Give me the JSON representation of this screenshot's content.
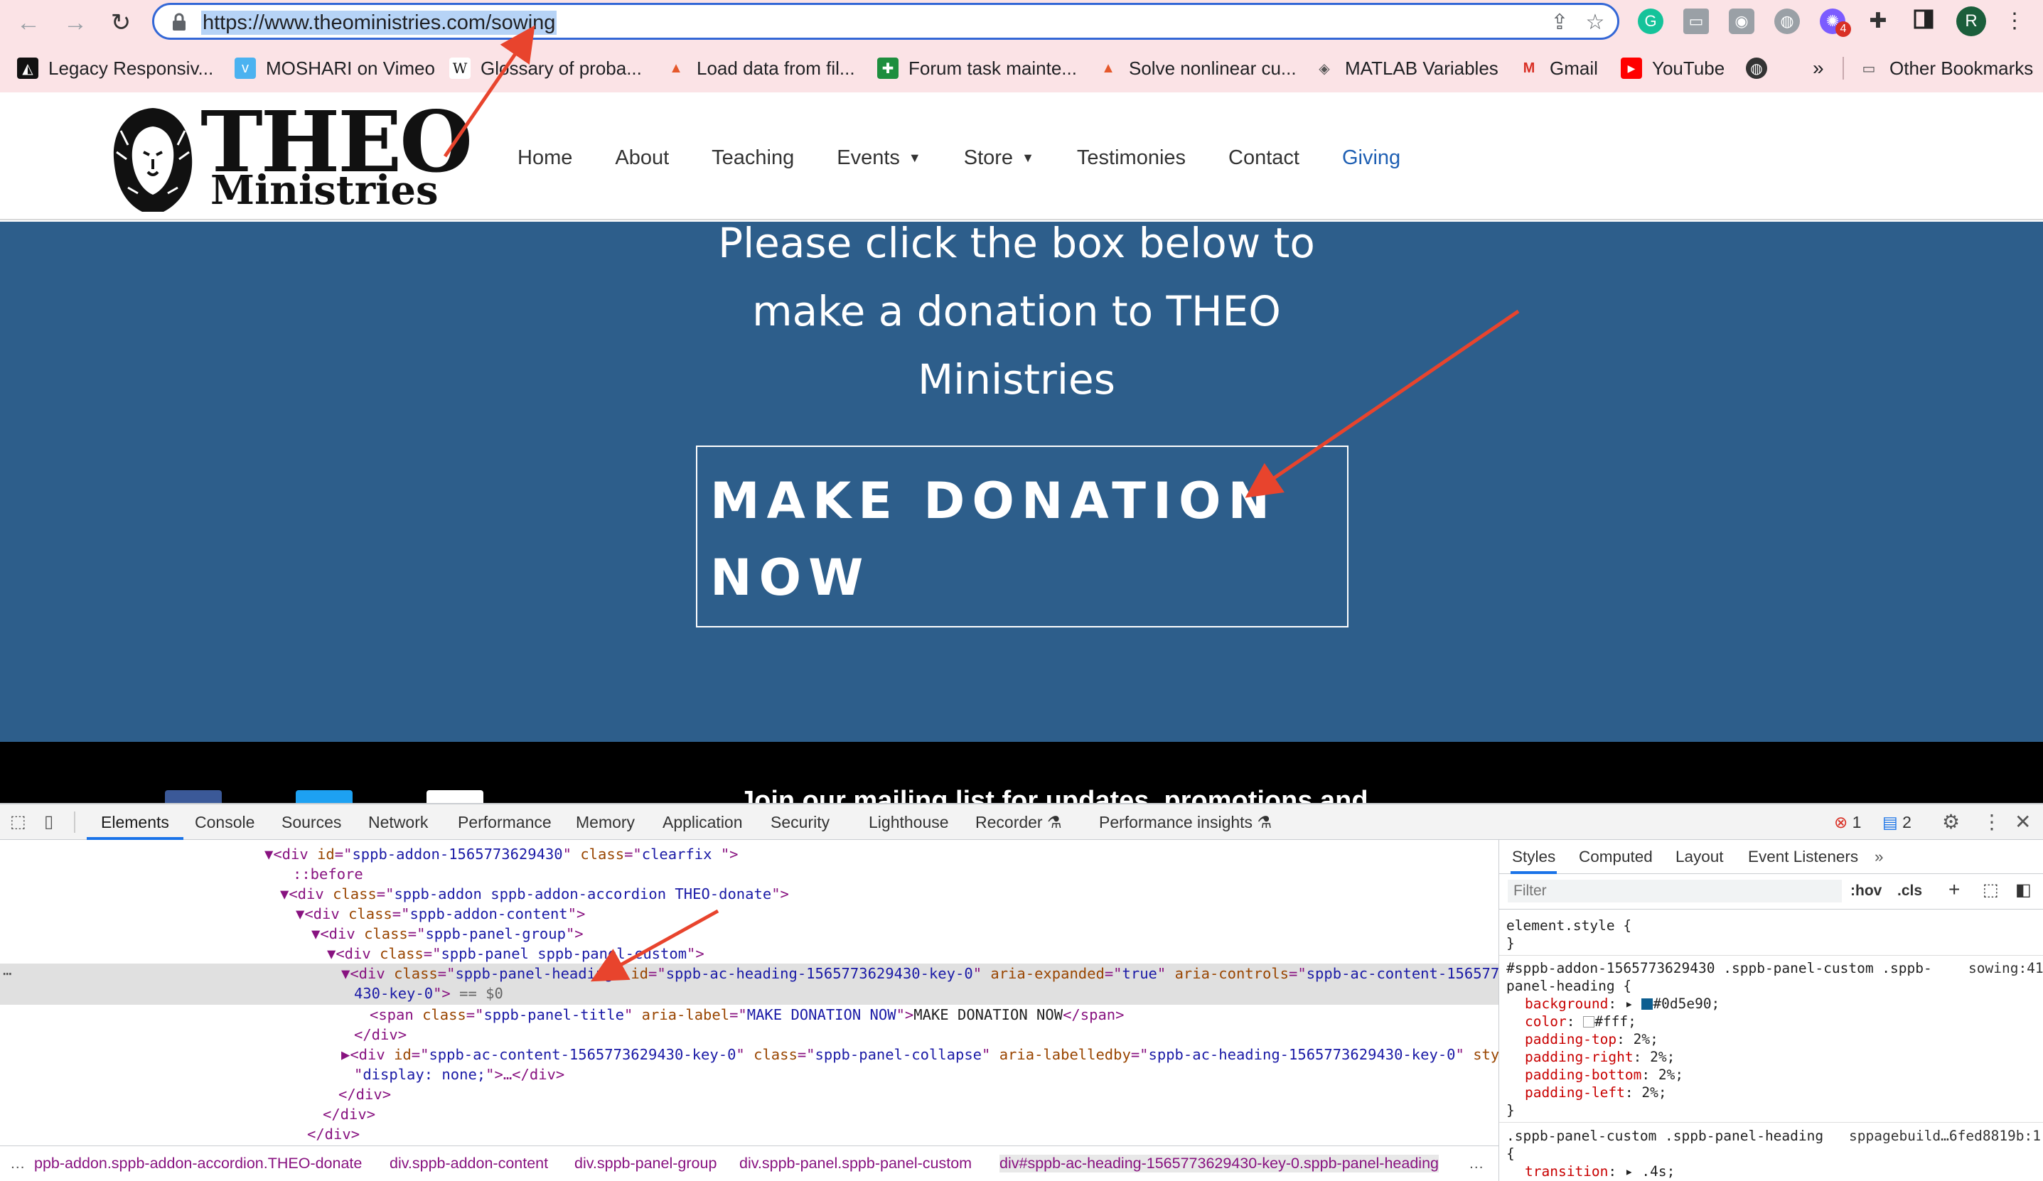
{
  "browser": {
    "url": "https://www.theoministries.com/sowing",
    "profile_initial": "R",
    "extension_badge": "4",
    "bookmarks": [
      {
        "label": "Legacy Responsiv...",
        "icon": "legacy-icon"
      },
      {
        "label": "MOSHARI on Vimeo",
        "icon": "vimeo-icon"
      },
      {
        "label": "Glossary of proba...",
        "icon": "wikipedia-icon"
      },
      {
        "label": "Load data from fil...",
        "icon": "matlab-icon"
      },
      {
        "label": "Forum task mainte...",
        "icon": "sheets-icon"
      },
      {
        "label": "Solve nonlinear cu...",
        "icon": "matlab-icon"
      },
      {
        "label": "MATLAB Variables",
        "icon": "matlab-diamond-icon"
      },
      {
        "label": "Gmail",
        "icon": "gmail-icon"
      },
      {
        "label": "YouTube",
        "icon": "youtube-icon"
      }
    ],
    "bookmarks_overflow": "»",
    "other_bookmarks": "Other Bookmarks"
  },
  "site": {
    "logo_title": "THEO",
    "logo_subtitle": "Ministries",
    "nav": [
      {
        "label": "Home"
      },
      {
        "label": "About"
      },
      {
        "label": "Teaching"
      },
      {
        "label": "Events",
        "has_dropdown": true
      },
      {
        "label": "Store",
        "has_dropdown": true
      },
      {
        "label": "Testimonies"
      },
      {
        "label": "Contact"
      },
      {
        "label": "Giving",
        "active": true
      }
    ],
    "hero_text": "Please click the box below to make a donation to THEO Ministries",
    "donate_label": "MAKE DONATION NOW",
    "mailing_text": "Join our mailing list for updates, promotions and",
    "colors": {
      "hero_bg": "#2d5e8b",
      "active_nav": "#1e5fb3"
    }
  },
  "devtools": {
    "tabs": [
      "Elements",
      "Console",
      "Sources",
      "Network",
      "Performance",
      "Memory",
      "Application",
      "Security",
      "Lighthouse",
      "Recorder",
      "Performance insights"
    ],
    "error_count": "1",
    "message_count": "2",
    "dom_lines": {
      "l1_id": "sppb-addon-1565773629430",
      "l1_class": "clearfix  ",
      "l2": "::before",
      "l3_class": "sppb-addon sppb-addon-accordion THEO-donate",
      "l4_class": "sppb-addon-content",
      "l5_class": "sppb-panel-group",
      "l6_class": "sppb-panel sppb-panel-custom",
      "l7_class": "sppb-panel-heading",
      "l7_id": "sppb-ac-heading-1565773629430-key-0",
      "l7_expanded": "true",
      "l7_controls": "sppb-ac-content-1565773629",
      "l7_cont": "430-key-0",
      "l7_eq": "== $0",
      "l8_class": "sppb-panel-title",
      "l8_label": "MAKE DONATION NOW",
      "l8_text": "MAKE DONATION NOW",
      "l10_id": "sppb-ac-content-1565773629430-key-0",
      "l10_class": "sppb-panel-collapse",
      "l10_labelledby": "sppb-ac-heading-1565773629430-key-0",
      "l10_style_cont": "display: none;"
    },
    "breadcrumbs": [
      "ppb-addon.sppb-addon-accordion.THEO-donate",
      "div.sppb-addon-content",
      "div.sppb-panel-group",
      "div.sppb-panel.sppb-panel-custom",
      "div#sppb-ac-heading-1565773629430-key-0.sppb-panel-heading"
    ],
    "styles_tabs": [
      "Styles",
      "Computed",
      "Layout",
      "Event Listeners"
    ],
    "filter_placeholder": "Filter",
    "hov": ":hov",
    "cls": ".cls",
    "rules": {
      "element_style": "element.style {",
      "close": "}",
      "rule1_selector_a": "#sppb-addon-1565773629430 .sppb-panel-custom .sppb-",
      "rule1_selector_b": "panel-heading {",
      "rule1_source": "sowing:41",
      "rule1_props": [
        {
          "name": "background",
          "value": "#0d5e90;"
        },
        {
          "name": "color",
          "value": "#fff;"
        },
        {
          "name": "padding-top",
          "value": "2%;"
        },
        {
          "name": "padding-right",
          "value": "2%;"
        },
        {
          "name": "padding-bottom",
          "value": "2%;"
        },
        {
          "name": "padding-left",
          "value": "2%;"
        }
      ],
      "rule2_selector": ".sppb-panel-custom .sppb-panel-heading",
      "rule2_source": "sppagebuild…6fed8819b:1",
      "rule2_open": "{",
      "rule2_prop": "transition",
      "rule2_value": ".4s;"
    }
  }
}
